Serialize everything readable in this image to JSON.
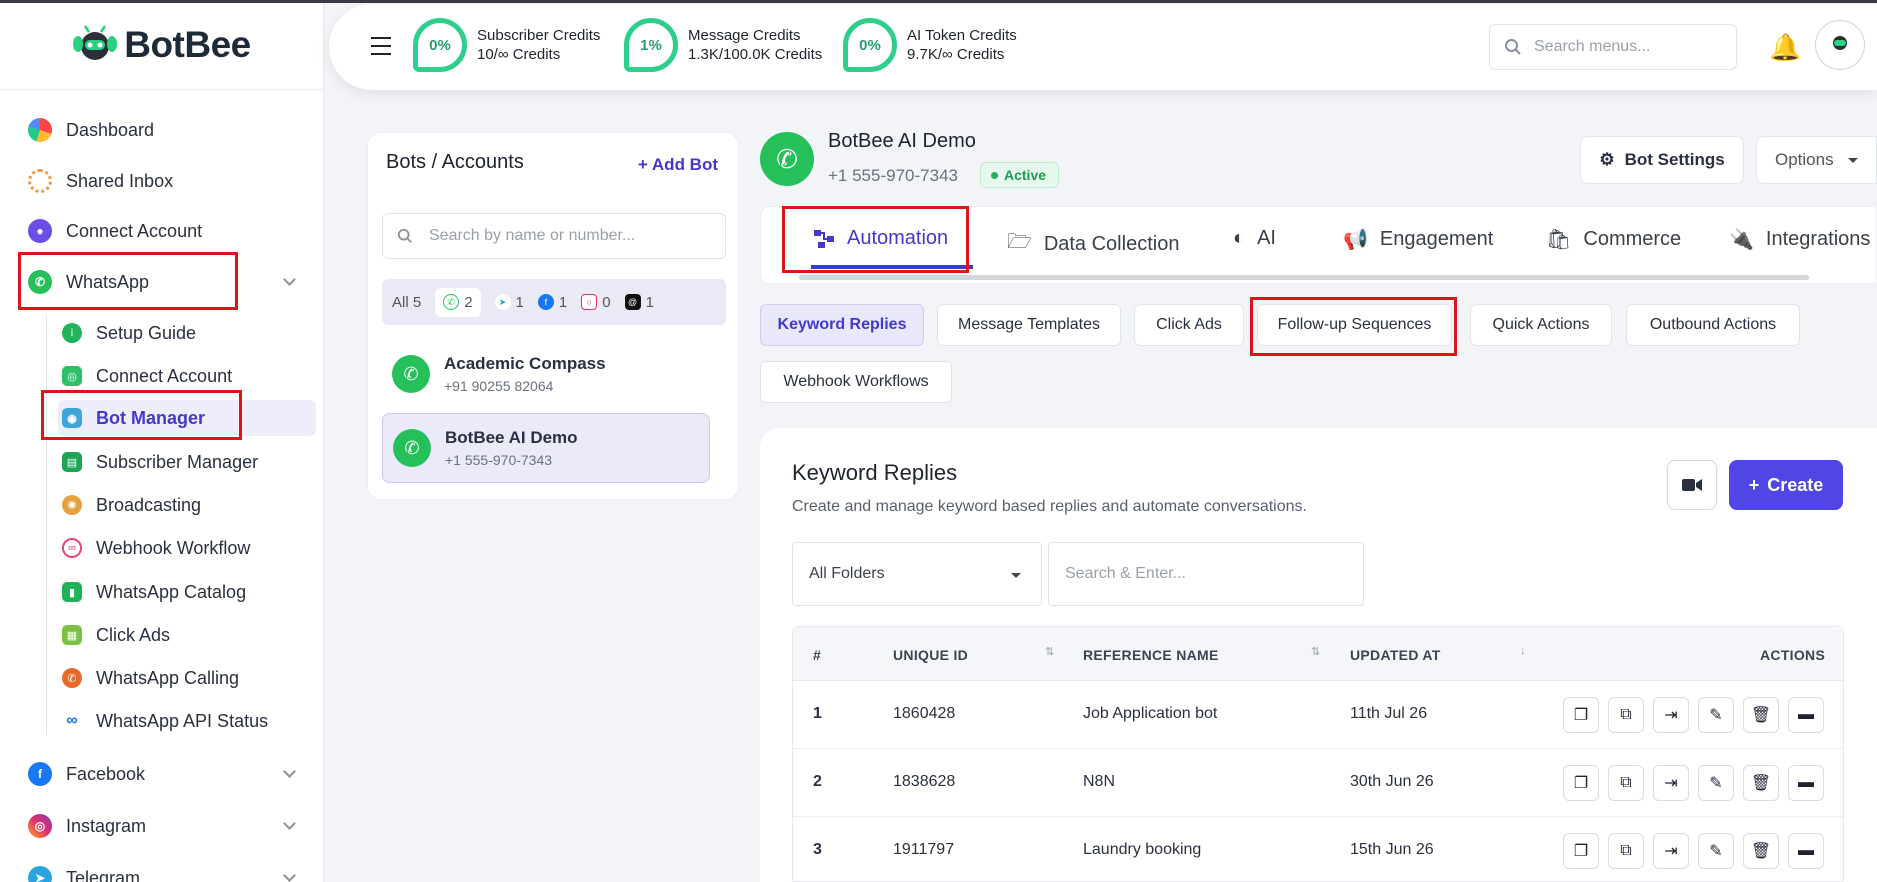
{
  "brand": {
    "name": "BotBee"
  },
  "sidebar": {
    "items": [
      {
        "label": "Dashboard"
      },
      {
        "label": "Shared Inbox"
      },
      {
        "label": "Connect Account"
      },
      {
        "label": "WhatsApp"
      },
      {
        "label": "Facebook"
      },
      {
        "label": "Instagram"
      },
      {
        "label": "Telegram"
      }
    ],
    "whatsapp_sub": [
      {
        "label": "Setup Guide"
      },
      {
        "label": "Connect Account"
      },
      {
        "label": "Bot Manager"
      },
      {
        "label": "Subscriber Manager"
      },
      {
        "label": "Broadcasting"
      },
      {
        "label": "Webhook Workflow"
      },
      {
        "label": "WhatsApp Catalog"
      },
      {
        "label": "Click Ads"
      },
      {
        "label": "WhatsApp Calling"
      },
      {
        "label": "WhatsApp API Status"
      }
    ]
  },
  "topbar": {
    "credits": [
      {
        "pct": "0%",
        "title": "Subscriber Credits",
        "value": "10/∞ Credits"
      },
      {
        "pct": "1%",
        "title": "Message Credits",
        "value": "1.3K/100.0K Credits"
      },
      {
        "pct": "0%",
        "title": "AI Token Credits",
        "value": "9.7K/∞ Credits"
      }
    ],
    "search_placeholder": "Search menus..."
  },
  "bots_panel": {
    "title": "Bots / Accounts",
    "add_label": "Add Bot",
    "search_placeholder": "Search by name or number...",
    "filters": [
      {
        "label": "All 5"
      },
      {
        "count": "2",
        "icon": "whatsapp-icon"
      },
      {
        "count": "1",
        "icon": "telegram-icon"
      },
      {
        "count": "1",
        "icon": "facebook-icon"
      },
      {
        "count": "0",
        "icon": "instagram-icon"
      },
      {
        "count": "1",
        "icon": "threads-icon"
      }
    ],
    "bots": [
      {
        "name": "Academic Compass",
        "number": "+91 90255 82064"
      },
      {
        "name": "BotBee AI Demo",
        "number": "+1 555-970-7343"
      }
    ]
  },
  "bot_header": {
    "name": "BotBee AI Demo",
    "number": "+1 555-970-7343",
    "status": "Active",
    "settings_label": "Bot Settings",
    "options_label": "Options"
  },
  "tabs": [
    {
      "label": "Automation"
    },
    {
      "label": "Data Collection"
    },
    {
      "label": "AI"
    },
    {
      "label": "Engagement"
    },
    {
      "label": "Commerce"
    },
    {
      "label": "Integrations"
    }
  ],
  "subtabs": [
    {
      "label": "Keyword Replies"
    },
    {
      "label": "Message Templates"
    },
    {
      "label": "Click Ads"
    },
    {
      "label": "Follow-up Sequences"
    },
    {
      "label": "Quick Actions"
    },
    {
      "label": "Outbound Actions"
    },
    {
      "label": "Webhook Workflows"
    }
  ],
  "content": {
    "title": "Keyword Replies",
    "subtitle": "Create and manage keyword based replies and automate conversations.",
    "create_label": "Create",
    "folder_select": "All Folders",
    "search_placeholder": "Search & Enter...",
    "columns": [
      "#",
      "UNIQUE ID",
      "REFERENCE NAME",
      "UPDATED AT",
      "ACTIONS"
    ],
    "rows": [
      {
        "idx": "1",
        "id": "1860428",
        "name": "Job Application bot",
        "updated": "11th Jul 26"
      },
      {
        "idx": "2",
        "id": "1838628",
        "name": "N8N",
        "updated": "30th Jun 26"
      },
      {
        "idx": "3",
        "id": "1911797",
        "name": "Laundry booking",
        "updated": "15th Jun 26"
      }
    ]
  },
  "colors": {
    "accent": "#4f46e5",
    "whatsapp_green": "#25c05a",
    "credit_ring": "#2ecf8c",
    "highlight_red": "#e0131b"
  }
}
